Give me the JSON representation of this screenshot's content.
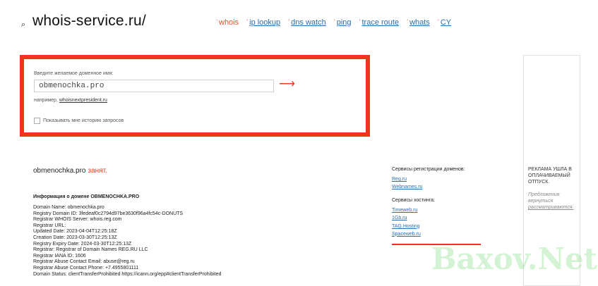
{
  "header": {
    "logo": "whois-service.ru/",
    "nav": [
      {
        "label": "whois",
        "active": true
      },
      {
        "label": "ip lookup",
        "active": false
      },
      {
        "label": "dns watch",
        "active": false
      },
      {
        "label": "ping",
        "active": false
      },
      {
        "label": "trace route",
        "active": false
      },
      {
        "label": "whats",
        "active": false
      },
      {
        "label": "CY",
        "active": false
      }
    ]
  },
  "search": {
    "label": "Введите желаемое доменное имя:",
    "value": "obmenochka.pro",
    "example_prefix": "например,",
    "example_link": "whoisnextpresident.ru",
    "history_label": "Показывать мне историю запросов"
  },
  "result": {
    "domain": "obmenochka.pro",
    "status": "занят.",
    "info_heading": "Информация о домене OBMENOCHKA.PRO",
    "lines": [
      "Domain Name: obmenochka.pro",
      "Registry Domain ID: 3fedeaf0c2794d97be3630f96a4fc54c-DONUTS",
      "Registrar WHOIS Server: whois.reg.com",
      "Registrar URL:",
      "Updated Date: 2023-04-04T12:25:18Z",
      "Creation Date: 2023-03-30T12:25:13Z",
      "Registry Expiry Date: 2024-03-30T12:25:13Z",
      "Registrar: Registrar of Domain Names REG.RU LLC",
      "Registrar IANA ID: 1606",
      "Registrar Abuse Contact Email: abuse@reg.ru",
      "Registrar Abuse Contact Phone: +7.4955801111",
      "Domain Status: clientTransferProhibited https://icann.org/epp#clientTransferProhibited"
    ]
  },
  "sidebar": {
    "registration_heading": "Сервисы регистрации доменов:",
    "registration_links": [
      "Reg.ru",
      "Webnames.ru"
    ],
    "hosting_heading": "Сервисы хостинга:",
    "hosting_links": [
      "Timeweb.ru",
      "1Gb.ru",
      "TAG.Hosting",
      "Spaceweb.ru"
    ]
  },
  "ad": {
    "title": "РЕКЛАМА УШЛА В ОПЛАЧИВАЕМЫЙ ОТПУСК.",
    "sub_text": "Предложения вернуться",
    "sub_link": "рассматриваются."
  },
  "watermark": "Baxov.Net",
  "colors": {
    "accent": "#f0341c",
    "link": "#2a6db0",
    "status": "#e0401e"
  }
}
